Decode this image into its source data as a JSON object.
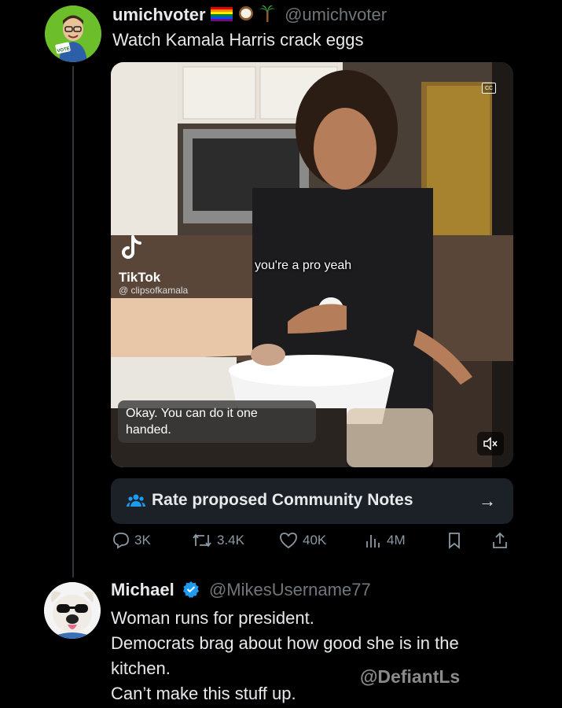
{
  "tweet1": {
    "author_name": "umichvoter",
    "author_handle": "@umichvoter",
    "text": "Watch Kamala Harris crack eggs",
    "avatar_badge": "VOTE"
  },
  "media": {
    "cc_badge": "CC",
    "watermark_brand": "TikTok",
    "watermark_handle": "@ clipsofkamala",
    "caption_top": "you're a pro yeah",
    "caption_bottom_line1": "Okay. You can do it one",
    "caption_bottom_line2": "handed."
  },
  "community_notes": {
    "label": "Rate proposed Community Notes",
    "arrow": "→"
  },
  "actions": {
    "replies": "3K",
    "reposts": "3.4K",
    "likes": "40K",
    "views": "4M"
  },
  "tweet2": {
    "author_name": "Michael",
    "author_handle": "@MikesUsername77",
    "lines": [
      "Woman runs for president.",
      "Democrats brag about how good she is in the",
      "kitchen.",
      "Can’t make this stuff up."
    ]
  },
  "watermark": "@DefiantLs",
  "colors": {
    "background": "#000000",
    "text": "#e7e9ea",
    "secondary": "#71767b",
    "verified": "#1d9bf0",
    "notes_bg": "#1c2127"
  }
}
